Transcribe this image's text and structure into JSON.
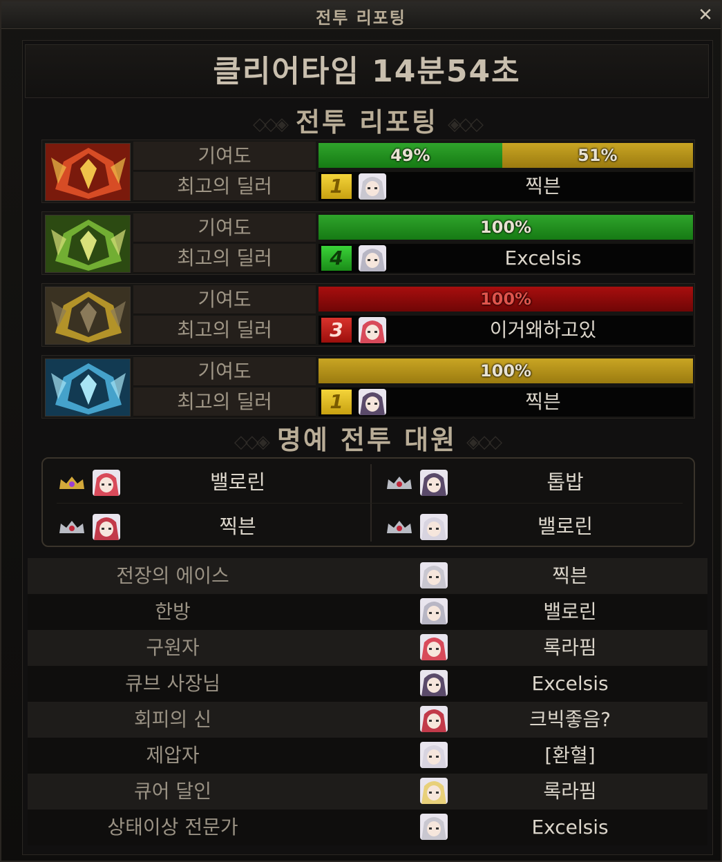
{
  "window": {
    "title": "전투 리포팅",
    "close_label": "✕"
  },
  "clear_time": "클리어타임 14분54초",
  "section_report": "전투 리포팅",
  "section_honor": "명예 전투 대원",
  "bosses": [
    {
      "icon": "fire-boss-icon",
      "contrib_label": "기여도",
      "dealer_label": "최고의 딜러",
      "segments": [
        {
          "text": "49%",
          "value": 49,
          "color": "green"
        },
        {
          "text": "51%",
          "value": 51,
          "color": "gold"
        }
      ],
      "rank": "1",
      "rank_color": "gold",
      "dealer": "찍븐"
    },
    {
      "icon": "nature-boss-icon",
      "contrib_label": "기여도",
      "dealer_label": "최고의 딜러",
      "segments": [
        {
          "text": "100%",
          "value": 100,
          "color": "green"
        }
      ],
      "rank": "4",
      "rank_color": "green",
      "dealer": "Excelsis"
    },
    {
      "icon": "earth-boss-icon",
      "contrib_label": "기여도",
      "dealer_label": "최고의 딜러",
      "segments": [
        {
          "text": "100%",
          "value": 100,
          "color": "red"
        }
      ],
      "rank": "3",
      "rank_color": "red",
      "dealer": "이거왜하고있"
    },
    {
      "icon": "ice-boss-icon",
      "contrib_label": "기여도",
      "dealer_label": "최고의 딜러",
      "segments": [
        {
          "text": "100%",
          "value": 100,
          "color": "gold"
        }
      ],
      "rank": "1",
      "rank_color": "gold",
      "dealer": "찍븐"
    }
  ],
  "honor_members": [
    {
      "name": "밸로린",
      "crown": "gold"
    },
    {
      "name": "톱밥",
      "crown": "silver"
    },
    {
      "name": "찍븐",
      "crown": "silver"
    },
    {
      "name": "밸로린",
      "crown": "silver"
    }
  ],
  "awards": [
    {
      "title": "전장의 에이스",
      "name": "찍븐"
    },
    {
      "title": "한방",
      "name": "밸로린"
    },
    {
      "title": "구원자",
      "name": "록라핌"
    },
    {
      "title": "큐브 사장님",
      "name": "Excelsis"
    },
    {
      "title": "회피의 신",
      "name": "크빅좋음?"
    },
    {
      "title": "제압자",
      "name": "[환혈]"
    },
    {
      "title": "큐어 달인",
      "name": "록라핌"
    },
    {
      "title": "상태이상 전문가",
      "name": "Excelsis"
    }
  ],
  "colors": {
    "green": "#2fa42b",
    "gold": "#c9a523",
    "red": "#a80e0e"
  }
}
